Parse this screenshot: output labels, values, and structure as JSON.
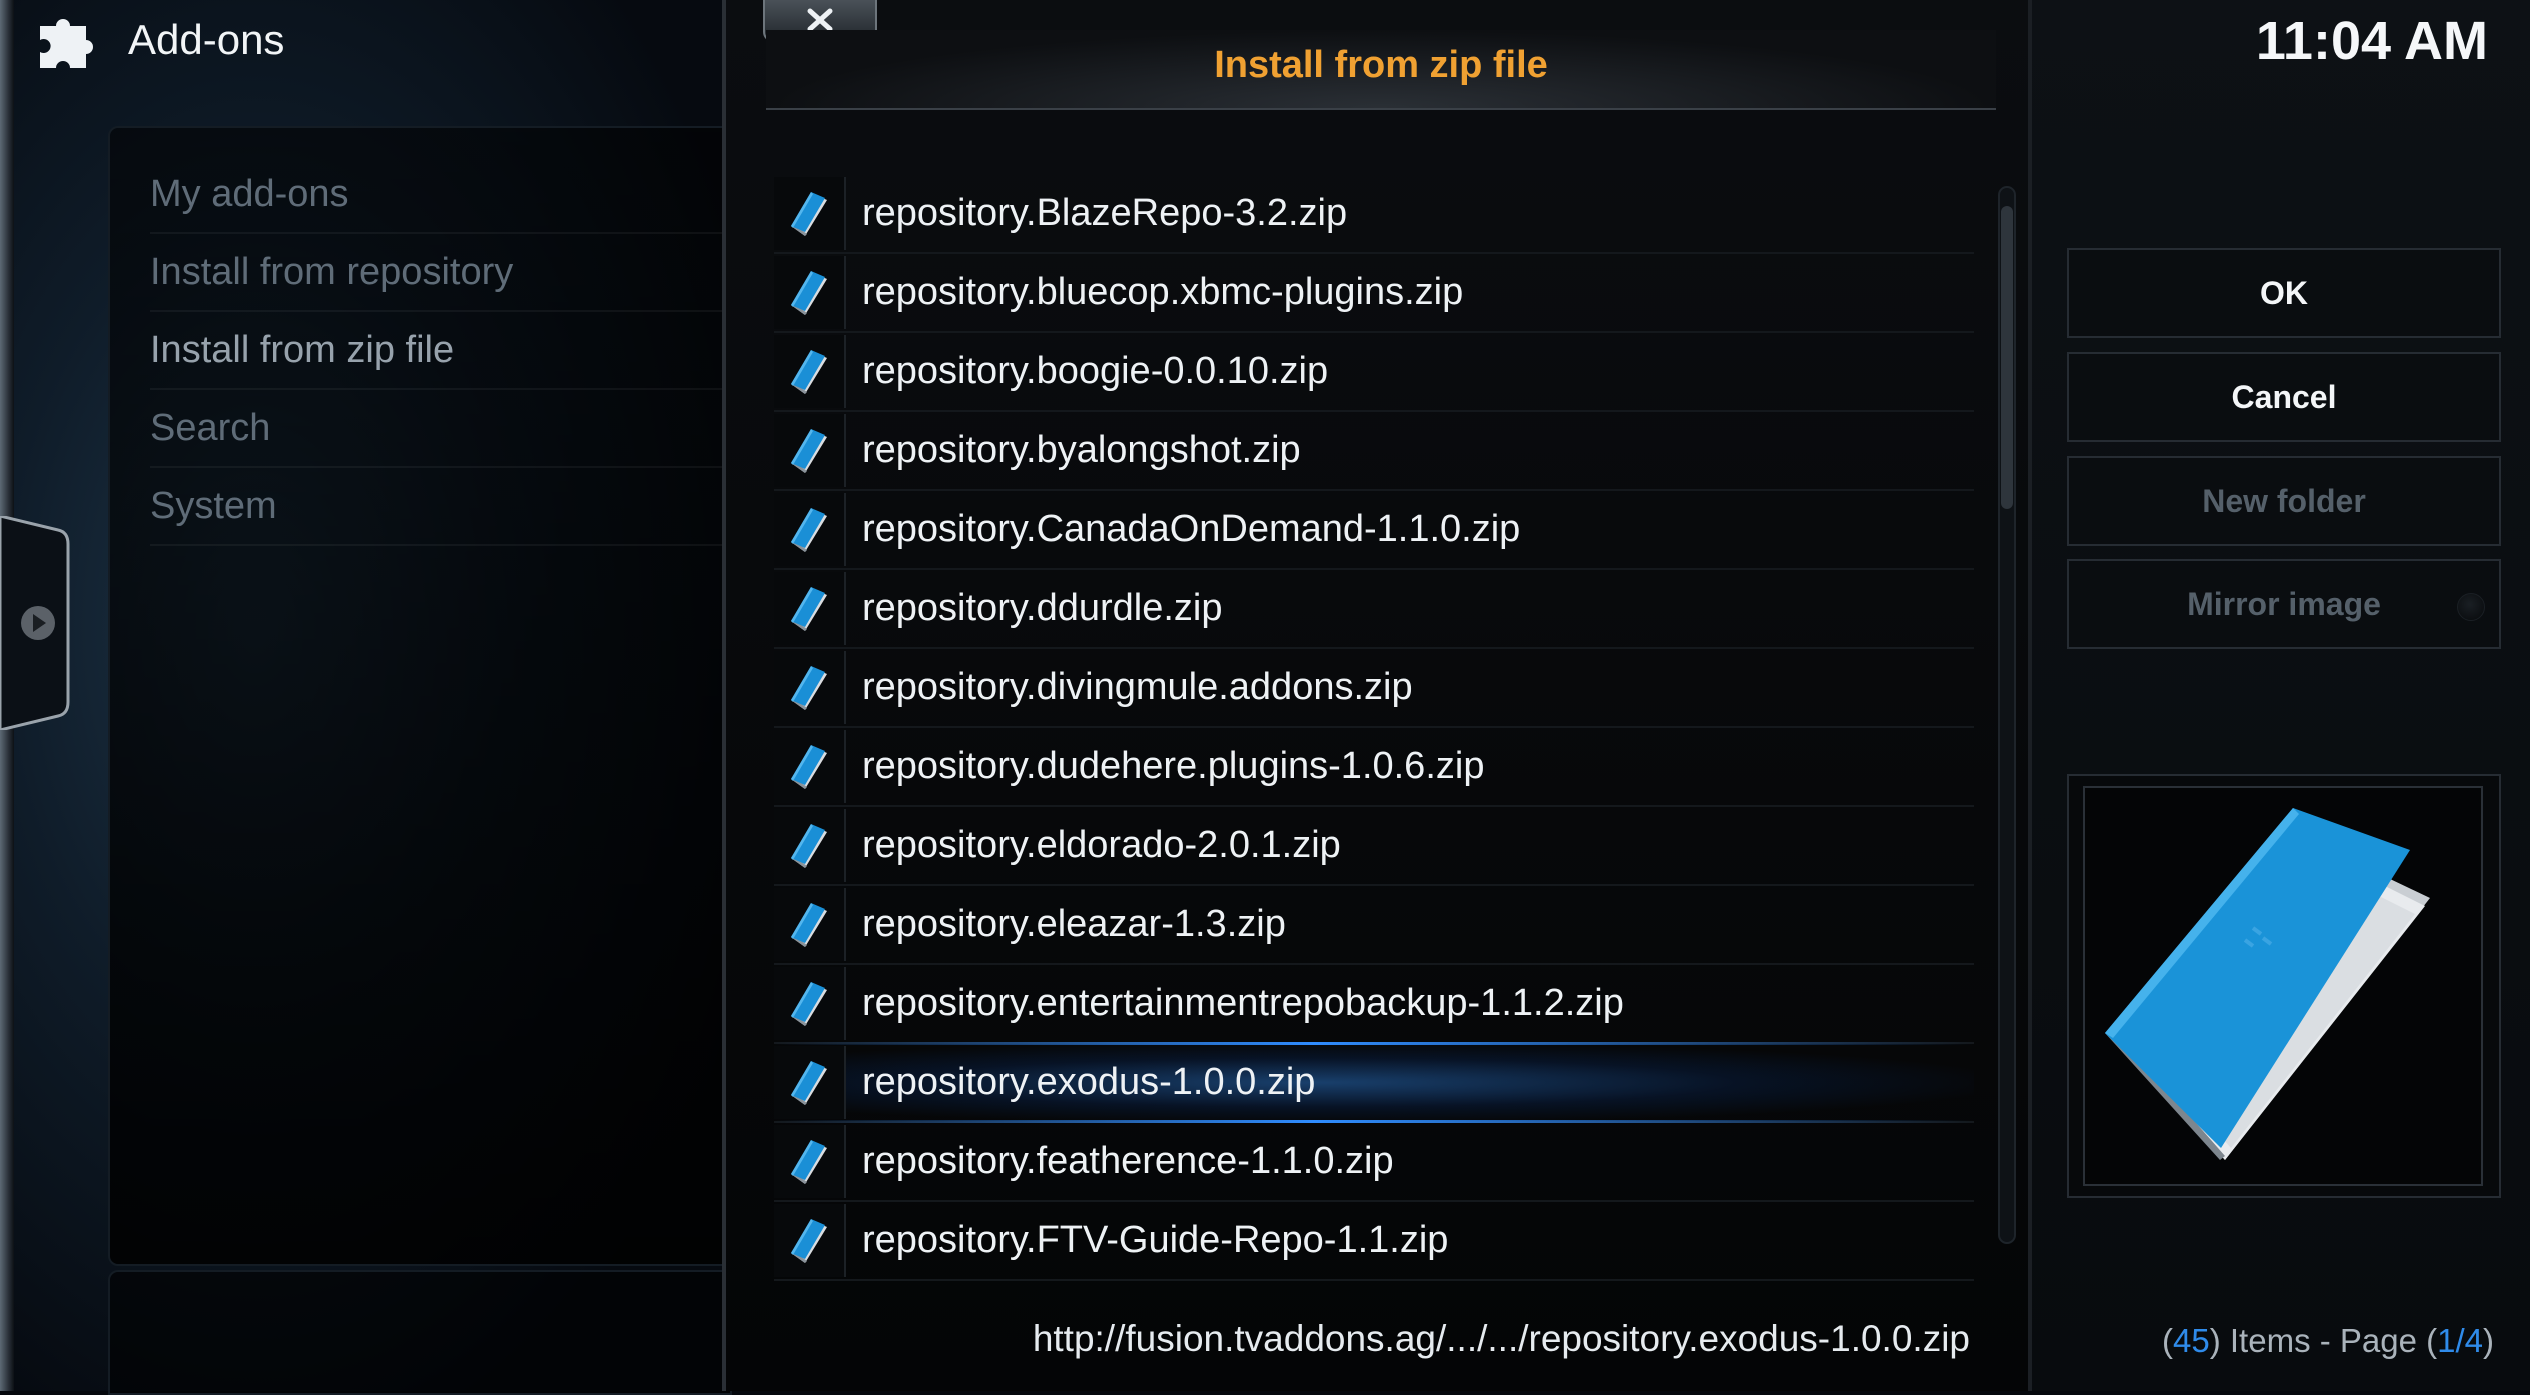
{
  "app": {
    "title": "Add-ons",
    "icon": "puzzle-piece-icon"
  },
  "menu": {
    "items": [
      {
        "label": "My add-ons",
        "active": false
      },
      {
        "label": "Install from repository",
        "active": false
      },
      {
        "label": "Install from zip file",
        "active": true
      },
      {
        "label": "Search",
        "active": false
      },
      {
        "label": "System",
        "active": false
      }
    ]
  },
  "dialog": {
    "title": "Install from zip file",
    "close_icon": "close-icon",
    "files": [
      {
        "name": "repository.BlazeRepo-3.2.zip",
        "selected": false
      },
      {
        "name": "repository.bluecop.xbmc-plugins.zip",
        "selected": false
      },
      {
        "name": "repository.boogie-0.0.10.zip",
        "selected": false
      },
      {
        "name": "repository.byalongshot.zip",
        "selected": false
      },
      {
        "name": "repository.CanadaOnDemand-1.1.0.zip",
        "selected": false
      },
      {
        "name": "repository.ddurdle.zip",
        "selected": false
      },
      {
        "name": "repository.divingmule.addons.zip",
        "selected": false
      },
      {
        "name": "repository.dudehere.plugins-1.0.6.zip",
        "selected": false
      },
      {
        "name": "repository.eldorado-2.0.1.zip",
        "selected": false
      },
      {
        "name": "repository.eleazar-1.3.zip",
        "selected": false
      },
      {
        "name": "repository.entertainmentrepobackup-1.1.2.zip",
        "selected": false
      },
      {
        "name": "repository.exodus-1.0.0.zip",
        "selected": true
      },
      {
        "name": "repository.featherence-1.1.0.zip",
        "selected": false
      },
      {
        "name": "repository.FTV-Guide-Repo-1.1.zip",
        "selected": false
      }
    ],
    "path": "http://fusion.tvaddons.ag/.../.../repository.exodus-1.0.0.zip",
    "scroll_fraction": 0.25
  },
  "right": {
    "clock": "11:04 AM",
    "buttons": {
      "ok": "OK",
      "cancel": "Cancel",
      "new_folder": "New folder",
      "mirror_image": "Mirror image"
    },
    "page_info": {
      "count": "45",
      "items_text": ") Items - Page (",
      "page": "1/4"
    }
  },
  "colors": {
    "title_accent": "#f0a132",
    "selection": "#2f8cff",
    "page_highlight": "#2f8bea",
    "file_icon_blue": "#1a8fd6"
  }
}
